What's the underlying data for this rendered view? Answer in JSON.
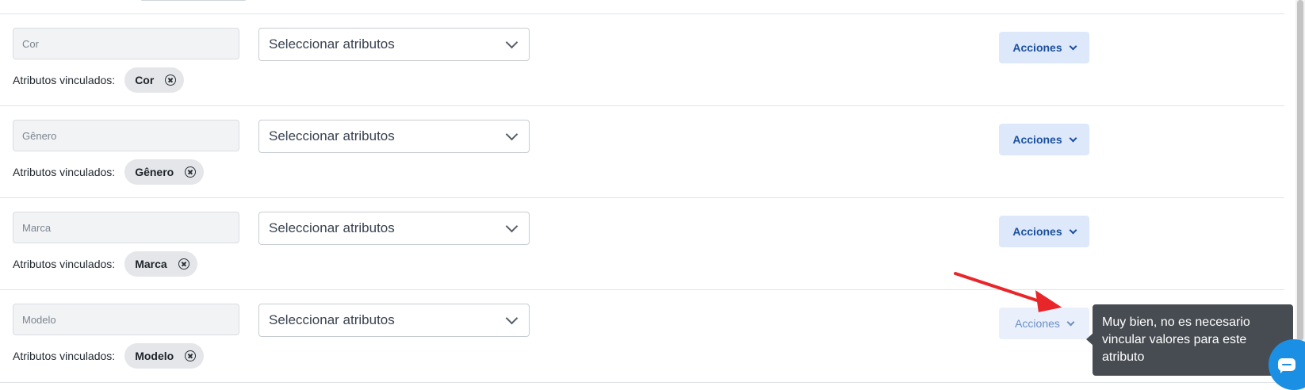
{
  "rows": [
    {
      "name_placeholder": "Cor",
      "select_label": "Seleccionar atributos",
      "linked_label": "Atributos vinculados:",
      "chip_label": "Cor",
      "actions_label": "Acciones"
    },
    {
      "name_placeholder": "Gênero",
      "select_label": "Seleccionar atributos",
      "linked_label": "Atributos vinculados:",
      "chip_label": "Gênero",
      "actions_label": "Acciones"
    },
    {
      "name_placeholder": "Marca",
      "select_label": "Seleccionar atributos",
      "linked_label": "Atributos vinculados:",
      "chip_label": "Marca",
      "actions_label": "Acciones"
    },
    {
      "name_placeholder": "Modelo",
      "select_label": "Seleccionar atributos",
      "linked_label": "Atributos vinculados:",
      "chip_label": "Modelo",
      "actions_label": "Acciones"
    }
  ],
  "tooltip": {
    "text": "Muy bien, no es necesario vincular valores para este atributo"
  },
  "colors": {
    "actions_button_bg": "#dde9fb",
    "actions_text": "#1b4f9c",
    "tooltip_bg": "#474c52",
    "annotation_arrow": "#e8262a",
    "chat_button": "#1a8fe3"
  },
  "icons": {
    "select": "chevron-down-icon",
    "chip_remove": "close-circle-icon",
    "chat": "chat-icon",
    "annotation": "red-arrow-icon"
  }
}
